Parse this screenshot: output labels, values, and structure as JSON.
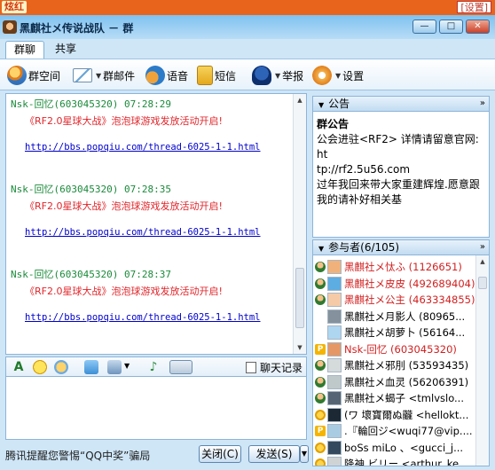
{
  "ad": {
    "brand": "炫红",
    "settings": "[设置]"
  },
  "window": {
    "title": "黑麒社メ传说战队  －  群",
    "minimize": "—",
    "maximize": "□",
    "close": "✕"
  },
  "tabs": [
    {
      "label": "群聊",
      "active": true
    },
    {
      "label": "共享",
      "active": false
    }
  ],
  "toolbar": {
    "items": [
      {
        "label": "群空间",
        "icon": "group-space-icon"
      },
      {
        "label": "群邮件",
        "icon": "mail-icon"
      },
      {
        "label": "语音",
        "icon": "voice-icon"
      },
      {
        "label": "短信",
        "icon": "sms-icon"
      },
      {
        "label": "举报",
        "icon": "report-icon"
      },
      {
        "label": "设置",
        "icon": "settings-icon"
      }
    ]
  },
  "messages": [
    {
      "sender": "Nsk-回忆(603045320) 07:28:29",
      "promo": "《RF2.0星球大战》泡泡球游戏发放活动开启!",
      "link": "http://bbs.popqiu.com/thread-6025-1-1.html"
    },
    {
      "sender": "Nsk-回忆(603045320) 07:28:35",
      "promo": "《RF2.0星球大战》泡泡球游戏发放活动开启!",
      "link": "http://bbs.popqiu.com/thread-6025-1-1.html"
    },
    {
      "sender": "Nsk-回忆(603045320) 07:28:37",
      "promo": "《RF2.0星球大战》泡泡球游戏发放活动开启!",
      "link": "http://bbs.popqiu.com/thread-6025-1-1.html"
    }
  ],
  "input_toolbar": {
    "font_glyph": "A",
    "music_glyph": "♪",
    "history_label": "聊天记录"
  },
  "footer": {
    "tip": "腾讯提醒您警惕“QQ中奖”骗局",
    "close_button": "关闭(C)",
    "send_button": "发送(S)",
    "send_arrow": "▼"
  },
  "notice": {
    "header": "公告",
    "title": "群公告",
    "lines": [
      "公会进驻<RF2> 详情请留意官网:ht",
      "tp://rf2.5u56.com",
      "过年我回来带大家重建辉煌.愿意跟",
      "我的请补好相关基"
    ]
  },
  "members_panel": {
    "header": "参与者(6/105)",
    "members": [
      {
        "name": "黑麒社メ忲ふ (1126651)",
        "color": "#d21f1f",
        "badge": "admin"
      },
      {
        "name": "黑麒社メ皮皮 (492689404)",
        "color": "#d21f1f",
        "badge": "admin"
      },
      {
        "name": "黑麒社メ公主 (463334855)",
        "color": "#d21f1f",
        "badge": "admin"
      },
      {
        "name": "黑麒社メ月影人 (80965...",
        "color": "#000000",
        "badge": "none"
      },
      {
        "name": "黑麒社メ胡萝卜 (56164...",
        "color": "#000000",
        "badge": "none"
      },
      {
        "name": "Nsk-回忆 (603045320)",
        "color": "#d21f1f",
        "badge": "p"
      },
      {
        "name": "黑麒社メ邪刖 (53593435)",
        "color": "#000000",
        "badge": "admin"
      },
      {
        "name": "黑麒社メ血灵 (56206391)",
        "color": "#000000",
        "badge": "admin"
      },
      {
        "name": "黑麒社メ蝎子 <tmlvslo...",
        "color": "#000000",
        "badge": "admin"
      },
      {
        "name": "(ワ 壞寶爾ぬ龖 <hellokt...",
        "color": "#000000",
        "badge": "star"
      },
      {
        "name": ".『輪回ジ<wuqi77@vip....",
        "color": "#000000",
        "badge": "p"
      },
      {
        "name": "boSs miLo 、<gucci_j...",
        "color": "#000000",
        "badge": "star"
      },
      {
        "name": "降神 ビリー <arthur_ke...",
        "color": "#000000",
        "badge": "star"
      }
    ]
  },
  "colors": {
    "sender": "#1a8a3a",
    "promo": "#e0262b",
    "link": "#0000cc",
    "window_bg": "#cfe6f7"
  }
}
